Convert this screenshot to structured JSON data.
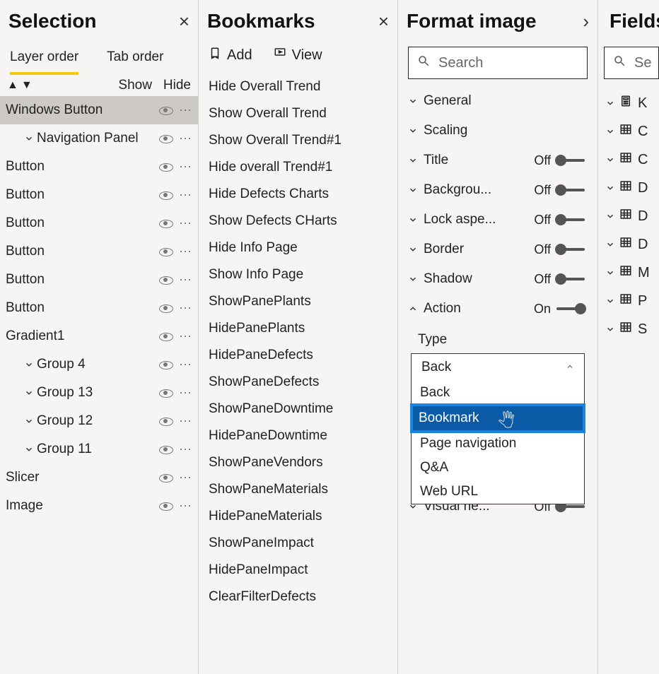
{
  "selection": {
    "title": "Selection",
    "tabs": {
      "layer_order": "Layer order",
      "tab_order": "Tab order"
    },
    "show_label": "Show",
    "hide_label": "Hide",
    "items": [
      {
        "label": "Windows Button",
        "indent": 0,
        "chevron": false,
        "selected": true
      },
      {
        "label": "Navigation Panel",
        "indent": 1,
        "chevron": true
      },
      {
        "label": "Button",
        "indent": 0,
        "chevron": false
      },
      {
        "label": "Button",
        "indent": 0,
        "chevron": false
      },
      {
        "label": "Button",
        "indent": 0,
        "chevron": false
      },
      {
        "label": "Button",
        "indent": 0,
        "chevron": false
      },
      {
        "label": "Button",
        "indent": 0,
        "chevron": false
      },
      {
        "label": "Button",
        "indent": 0,
        "chevron": false
      },
      {
        "label": "Gradient1",
        "indent": 0,
        "chevron": false
      },
      {
        "label": "Group 4",
        "indent": 1,
        "chevron": true
      },
      {
        "label": "Group 13",
        "indent": 1,
        "chevron": true
      },
      {
        "label": "Group 12",
        "indent": 1,
        "chevron": true
      },
      {
        "label": "Group 11",
        "indent": 1,
        "chevron": true
      },
      {
        "label": "Slicer",
        "indent": 0,
        "chevron": false
      },
      {
        "label": "Image",
        "indent": 0,
        "chevron": false
      }
    ]
  },
  "bookmarks": {
    "title": "Bookmarks",
    "add_label": "Add",
    "view_label": "View",
    "items": [
      "Hide Overall Trend",
      "Show Overall Trend",
      "Show Overall Trend#1",
      "Hide overall Trend#1",
      "Hide Defects Charts",
      "Show Defects CHarts",
      "Hide Info Page",
      "Show Info Page",
      "ShowPanePlants",
      "HidePanePlants",
      "HidePaneDefects",
      "ShowPaneDefects",
      "ShowPaneDowntime",
      "HidePaneDowntime",
      "ShowPaneVendors",
      "ShowPaneMaterials",
      "HidePaneMaterials",
      "ShowPaneImpact",
      "HidePaneImpact",
      "ClearFilterDefects"
    ]
  },
  "format": {
    "title": "Format image",
    "search_placeholder": "Search",
    "groups": [
      {
        "label": "General",
        "toggle": null,
        "open": false
      },
      {
        "label": "Scaling",
        "toggle": null,
        "open": false
      },
      {
        "label": "Title",
        "toggle": "Off",
        "open": false
      },
      {
        "label": "Backgrou...",
        "toggle": "Off",
        "open": false
      },
      {
        "label": "Lock aspe...",
        "toggle": "Off",
        "open": false
      },
      {
        "label": "Border",
        "toggle": "Off",
        "open": false
      },
      {
        "label": "Shadow",
        "toggle": "Off",
        "open": false
      },
      {
        "label": "Action",
        "toggle": "On",
        "open": true
      }
    ],
    "action": {
      "type_label": "Type",
      "selected": "Back",
      "options": [
        "Back",
        "Bookmark",
        "Page navigation",
        "Q&A",
        "Web URL"
      ],
      "highlight_index": 1
    },
    "visual_header": {
      "label": "Visual he...",
      "toggle": "Off"
    }
  },
  "fields": {
    "title": "Fields",
    "search_placeholder": "Se",
    "items": [
      {
        "icon": "calc",
        "char": "K"
      },
      {
        "icon": "table",
        "char": "C"
      },
      {
        "icon": "table",
        "char": "C"
      },
      {
        "icon": "table",
        "char": "D"
      },
      {
        "icon": "table",
        "char": "D"
      },
      {
        "icon": "table",
        "char": "D"
      },
      {
        "icon": "table",
        "char": "M"
      },
      {
        "icon": "table",
        "char": "P"
      },
      {
        "icon": "table",
        "char": "S"
      }
    ]
  }
}
